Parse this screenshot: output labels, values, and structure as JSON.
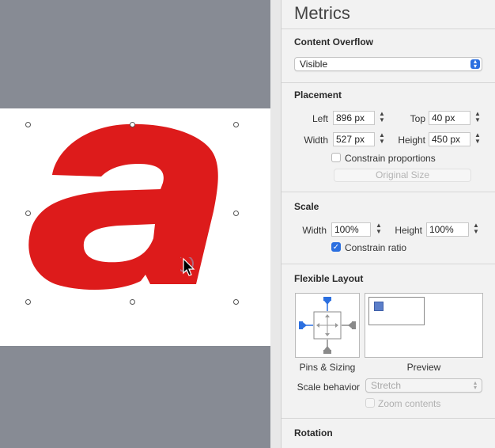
{
  "inspector": {
    "title": "Metrics",
    "content_overflow": {
      "heading": "Content Overflow",
      "selected": "Visible"
    },
    "placement": {
      "heading": "Placement",
      "left_label": "Left",
      "left_value": "896 px",
      "top_label": "Top",
      "top_value": "40 px",
      "width_label": "Width",
      "width_value": "527 px",
      "height_label": "Height",
      "height_value": "450 px",
      "constrain_label": "Constrain proportions",
      "original_size_label": "Original Size"
    },
    "scale": {
      "heading": "Scale",
      "width_label": "Width",
      "width_value": "100%",
      "height_label": "Height",
      "height_value": "100%",
      "constrain_label": "Constrain ratio"
    },
    "flexible_layout": {
      "heading": "Flexible Layout",
      "pins_caption": "Pins & Sizing",
      "preview_caption": "Preview",
      "scale_behavior_label": "Scale behavior",
      "scale_behavior_value": "Stretch",
      "zoom_label": "Zoom contents"
    },
    "rotation": {
      "heading": "Rotation"
    }
  },
  "colors": {
    "letter_fill": "#dd1b1b",
    "accent": "#2b6fe0",
    "canvas_bg": "#878b94"
  },
  "icons": [
    "selection-handle",
    "pointer-cursor",
    "pin-icon",
    "popup-arrows-icon",
    "checkmark-icon"
  ]
}
